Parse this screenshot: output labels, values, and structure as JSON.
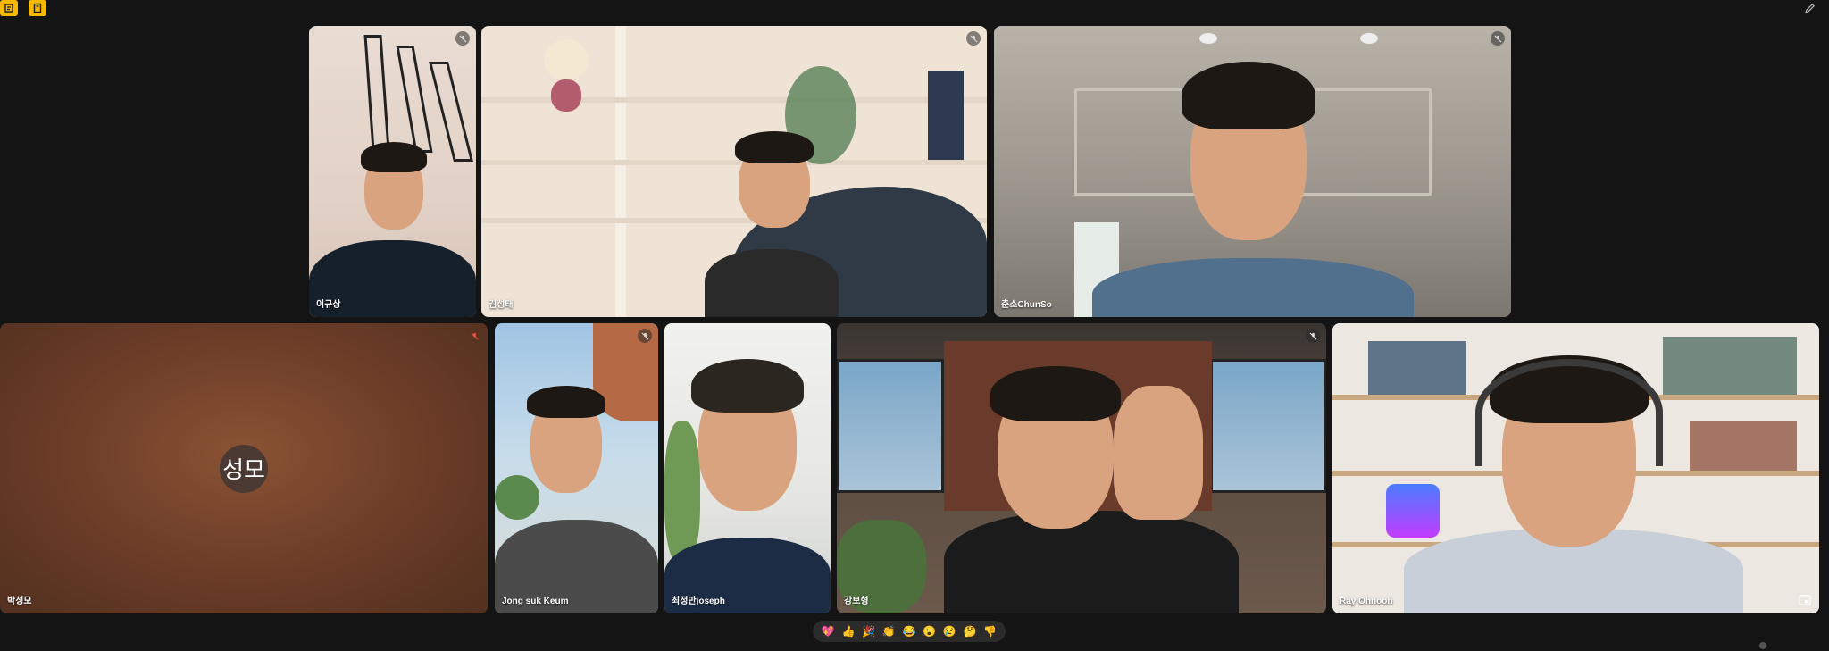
{
  "app": {
    "left_icons": [
      "notes-icon",
      "activities-icon"
    ],
    "right_icon": "pen-icon"
  },
  "participants": [
    {
      "id": "p1",
      "name": "이규상",
      "muted": true
    },
    {
      "id": "p2",
      "name": "김성태",
      "muted": true
    },
    {
      "id": "p3",
      "name": "춘소ChunSo",
      "muted": true
    },
    {
      "id": "p4",
      "name": "박성모",
      "muted": true,
      "avatar_initials": "성모"
    },
    {
      "id": "p5",
      "name": "Jong suk Keum",
      "muted": true
    },
    {
      "id": "p6",
      "name": "최정만joseph",
      "muted": false
    },
    {
      "id": "p7",
      "name": "강보형",
      "muted": true
    },
    {
      "id": "p8",
      "name": "Ray Ohnoon",
      "muted": false,
      "active_speaker": true
    }
  ],
  "reactions": [
    "💖",
    "👍",
    "🎉",
    "👏",
    "😂",
    "😮",
    "😢",
    "🤔",
    "👎"
  ],
  "colors": {
    "background": "#141414",
    "accent_icon": "#f6b900",
    "active_outline": "#8ab4f8",
    "muted_red": "#e8553e"
  }
}
